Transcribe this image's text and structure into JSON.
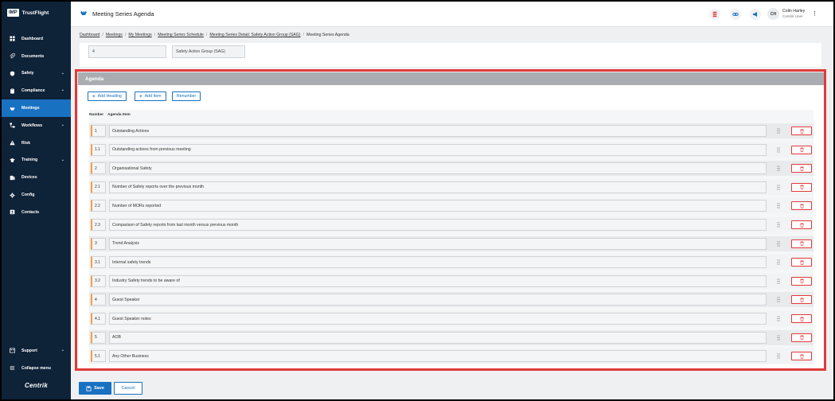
{
  "app": {
    "logo_badge": "IMP",
    "logo_text": "TrustFlight",
    "brand": "Centrik"
  },
  "sidebar": {
    "items": [
      {
        "label": "Dashboard",
        "icon": "dashboard-icon",
        "chevron": false,
        "active": false
      },
      {
        "label": "Documents",
        "icon": "paperclip-icon",
        "chevron": false,
        "active": false
      },
      {
        "label": "Safety",
        "icon": "shield-icon",
        "chevron": true,
        "active": false
      },
      {
        "label": "Compliance",
        "icon": "clipboard-icon",
        "chevron": true,
        "active": false
      },
      {
        "label": "Meetings",
        "icon": "handshake-icon",
        "chevron": false,
        "active": true
      },
      {
        "label": "Workflows",
        "icon": "workflow-icon",
        "chevron": true,
        "active": false
      },
      {
        "label": "Risk",
        "icon": "warning-icon",
        "chevron": false,
        "active": false
      },
      {
        "label": "Training",
        "icon": "graduation-icon",
        "chevron": true,
        "active": false
      },
      {
        "label": "Devices",
        "icon": "devices-icon",
        "chevron": false,
        "active": false
      },
      {
        "label": "Config",
        "icon": "gear-icon",
        "chevron": false,
        "active": false
      },
      {
        "label": "Contacts",
        "icon": "contacts-icon",
        "chevron": false,
        "active": false
      }
    ],
    "support_label": "Support",
    "collapse_label": "Collapse menu"
  },
  "header": {
    "title": "Meeting Series Agenda",
    "user_initials": "CH",
    "user_name": "Colin Harley",
    "user_role": "Centrik User"
  },
  "breadcrumb": [
    {
      "label": "Dashboard",
      "link": true
    },
    {
      "label": "Meetings",
      "link": true
    },
    {
      "label": "My Meetings",
      "link": true
    },
    {
      "label": "Meeting Series Schedule",
      "link": true
    },
    {
      "label": "Meeting Series Detail: Safety Action Group (SAG)",
      "link": true
    },
    {
      "label": "Meeting Series Agenda",
      "link": false
    }
  ],
  "top_fields": {
    "number": "4",
    "name": "Safety Action Group (SAG)"
  },
  "agenda": {
    "title": "Agenda",
    "add_heading_label": "Add Heading",
    "add_item_label": "Add Item",
    "renumber_label": "Renumber",
    "col_number": "Number",
    "col_item": "Agenda Item",
    "rows": [
      {
        "number": "1",
        "item": "Outstanding Actions",
        "heading": true
      },
      {
        "number": "1.1",
        "item": "Outstanding actions from previous meeting",
        "heading": false
      },
      {
        "number": "2",
        "item": "Organisational Safety",
        "heading": true
      },
      {
        "number": "2.1",
        "item": "Number of Safety reports over the previous month",
        "heading": false
      },
      {
        "number": "2.2",
        "item": "Number of MORs reported",
        "heading": false
      },
      {
        "number": "2.3",
        "item": "Comparison of Safety reports from last month versus previous month",
        "heading": false
      },
      {
        "number": "3",
        "item": "Trend Analysis",
        "heading": true
      },
      {
        "number": "3.1",
        "item": "Internal safety trends",
        "heading": false
      },
      {
        "number": "3.2",
        "item": "Industry Safety trends to be aware of",
        "heading": false
      },
      {
        "number": "4",
        "item": "Guest Speaker",
        "heading": true
      },
      {
        "number": "4.1",
        "item": "Guest Speaker notes",
        "heading": false
      },
      {
        "number": "5",
        "item": "AOB",
        "heading": true
      },
      {
        "number": "5.1",
        "item": "Any Other Business",
        "heading": false
      }
    ]
  },
  "footer": {
    "save_label": "Save",
    "cancel_label": "Cancel"
  },
  "colors": {
    "sidebar_bg": "#0e2238",
    "accent": "#1971c2",
    "danger": "#e03a3a",
    "number_marker": "#f0a04b",
    "panel_header": "#a9adb1"
  }
}
